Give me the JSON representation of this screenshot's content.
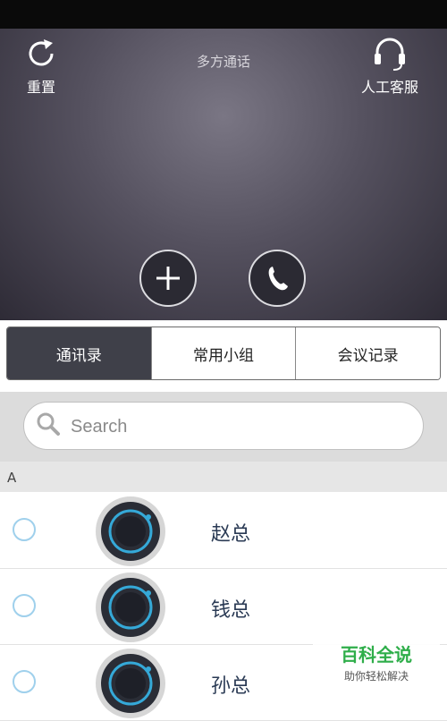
{
  "header": {
    "title": "多方通话",
    "reset_label": "重置",
    "service_label": "人工客服"
  },
  "tabs": [
    {
      "label": "通讯录",
      "active": true
    },
    {
      "label": "常用小组",
      "active": false
    },
    {
      "label": "会议记录",
      "active": false
    }
  ],
  "search": {
    "placeholder": "Search"
  },
  "section_letter": "A",
  "contacts": [
    {
      "name": "赵总"
    },
    {
      "name": "钱总"
    },
    {
      "name": "孙总"
    }
  ],
  "watermark": {
    "main": "百科全说",
    "sub": "助你轻松解决"
  },
  "colors": {
    "active_tab": "#3f4049",
    "radio_border": "#9fd0ec",
    "name_text": "#2a3a54"
  }
}
